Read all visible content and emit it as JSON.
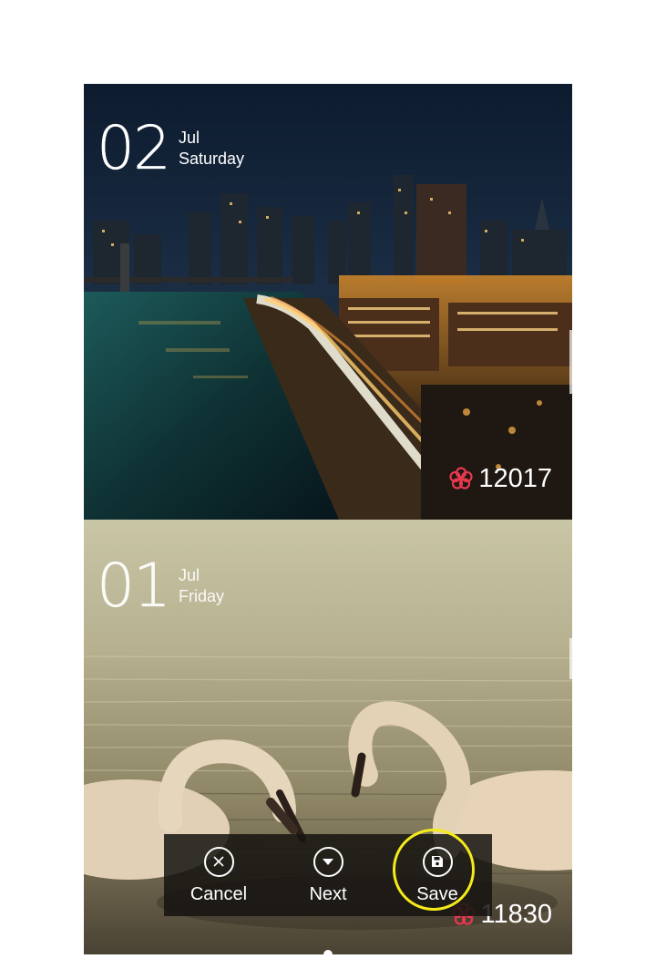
{
  "cards": [
    {
      "day": "02",
      "month": "Jul",
      "weekday": "Saturday",
      "likes": "12017",
      "scene": "city-night-bridge"
    },
    {
      "day": "01",
      "month": "Jul",
      "weekday": "Friday",
      "likes": "11830",
      "scene": "swans-lake"
    }
  ],
  "toolbar": {
    "cancel": "Cancel",
    "next": "Next",
    "save": "Save"
  },
  "icons": {
    "like": "flower-icon",
    "cancel": "close-circle-icon",
    "next": "chevron-down-circle-icon",
    "save": "floppy-disk-icon"
  },
  "colors": {
    "like_icon": "#e8384f",
    "highlight": "#f5ea1a"
  }
}
